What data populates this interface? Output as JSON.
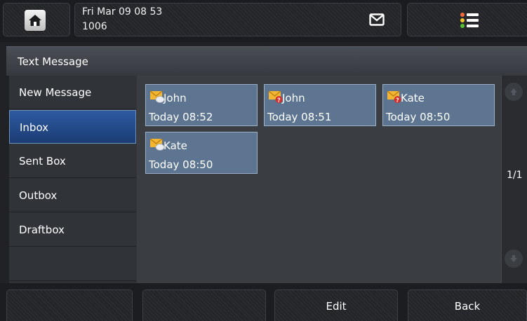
{
  "status_bar": {
    "date": "Fri Mar 09 08 53",
    "extension": "1006",
    "icons": {
      "home": "home-icon",
      "mail": "mail-icon",
      "menu": "menu-list-icon"
    }
  },
  "screen": {
    "title": "Text Message"
  },
  "nav": {
    "items": [
      {
        "label": "New Message"
      },
      {
        "label": "Inbox",
        "selected": true
      },
      {
        "label": "Sent Box"
      },
      {
        "label": "Outbox"
      },
      {
        "label": "Draftbox"
      }
    ]
  },
  "messages": [
    {
      "sender": "John",
      "time": "Today 08:52",
      "status_icon": "read-envelope-icon"
    },
    {
      "sender": "John",
      "time": "Today 08:51",
      "status_icon": "unread-envelope-icon"
    },
    {
      "sender": "Kate",
      "time": "Today 08:50",
      "status_icon": "unread-envelope-icon"
    },
    {
      "sender": "Kate",
      "time": "Today 08:50",
      "status_icon": "read-envelope-icon"
    }
  ],
  "pagination": {
    "indicator": "1/1"
  },
  "softkeys": {
    "key1": "",
    "key2": "",
    "key3": "Edit",
    "key4": "Back"
  },
  "colors": {
    "selected_nav": "#1f4380",
    "tile_bg": "#5d7590",
    "content_bg": "#3a3d42",
    "envelope": "#f2b632",
    "unread_badge": "#d2302a"
  }
}
